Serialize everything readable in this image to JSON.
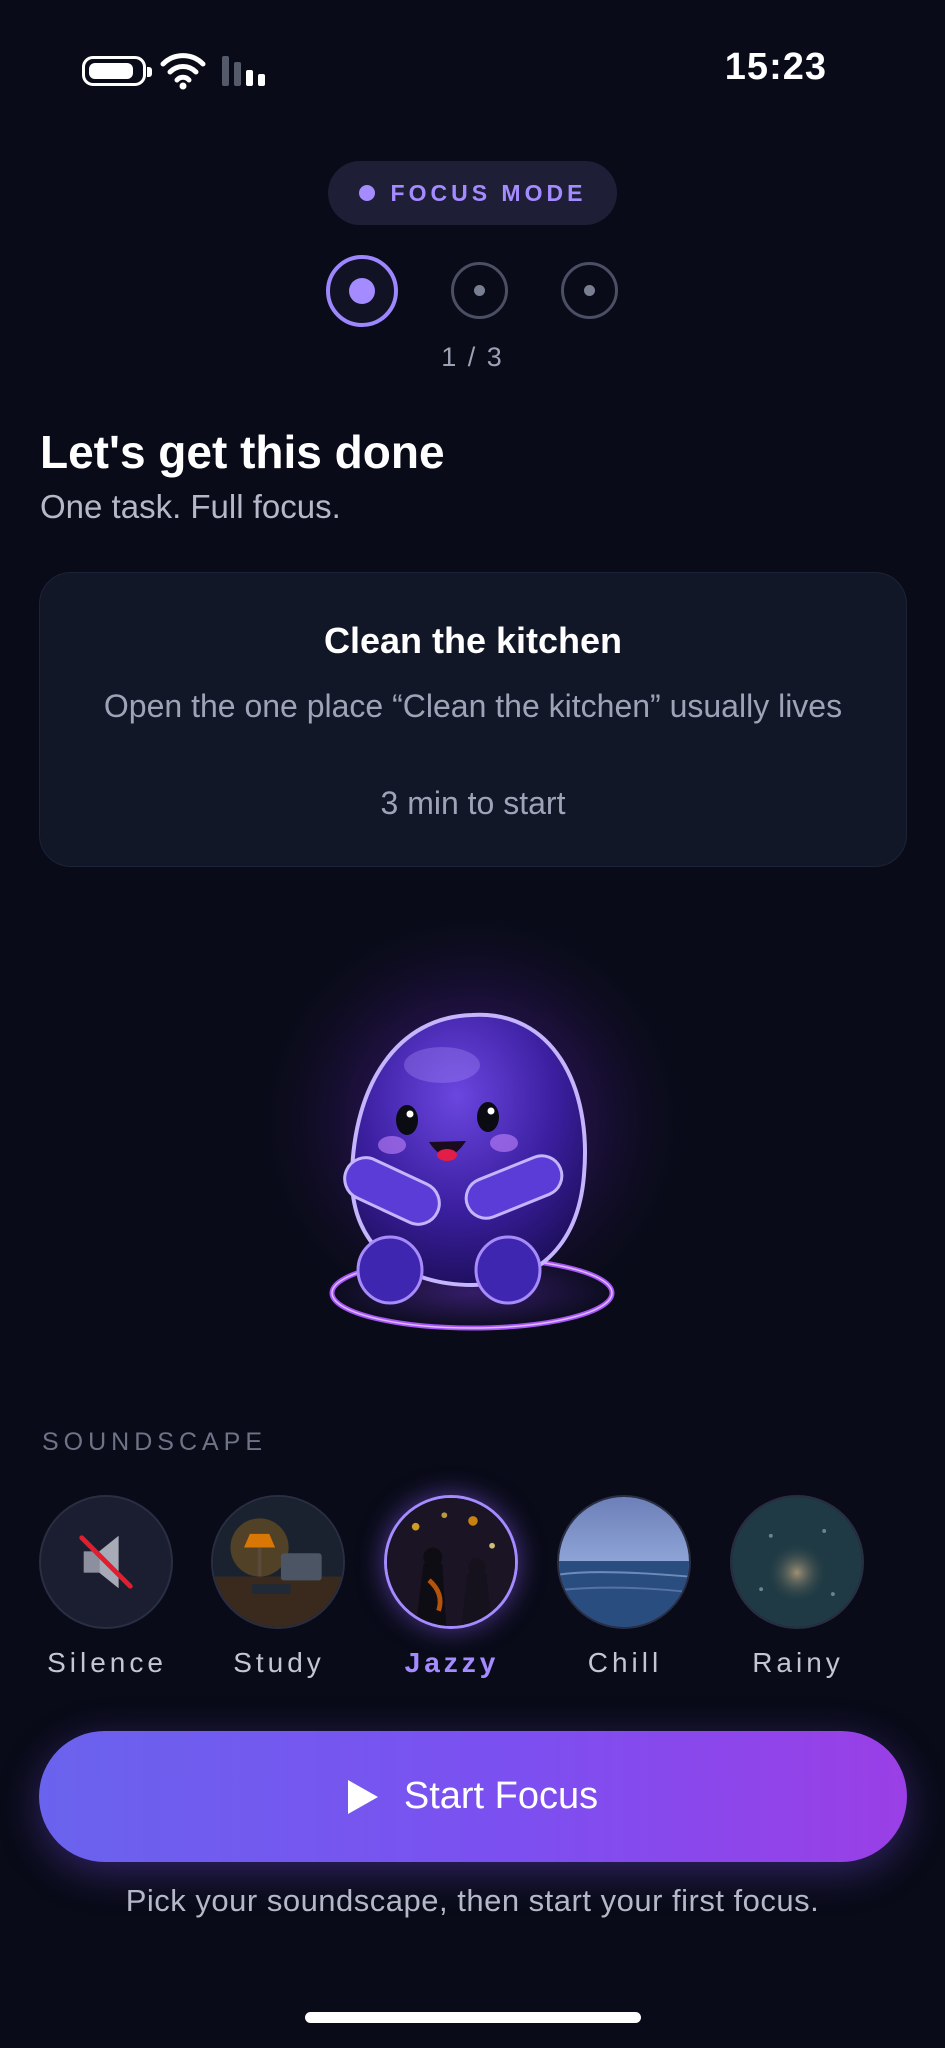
{
  "status_bar": {
    "time": "15:23"
  },
  "focus_badge": {
    "label": "FOCUS MODE"
  },
  "progress": {
    "current": 1,
    "total": 3,
    "label": "1 / 3"
  },
  "header": {
    "title": "Let's get this done",
    "subtitle": "One task. Full focus."
  },
  "task": {
    "title": "Clean the kitchen",
    "description": "Open the one place “Clean the kitchen” usually lives",
    "time_hint": "3 min to start"
  },
  "soundscape": {
    "label": "SOUNDSCAPE",
    "selected": "Jazzy",
    "options": [
      {
        "name": "Silence"
      },
      {
        "name": "Study"
      },
      {
        "name": "Jazzy"
      },
      {
        "name": "Chill"
      },
      {
        "name": "Rainy"
      }
    ]
  },
  "start_button": {
    "label": "Start Focus"
  },
  "hint": "Pick your soundscape, then start your first focus.",
  "colors": {
    "accent": "#a48bff",
    "background": "#090b18",
    "button_start": "#6a63ee",
    "button_end": "#9a3fe6"
  }
}
